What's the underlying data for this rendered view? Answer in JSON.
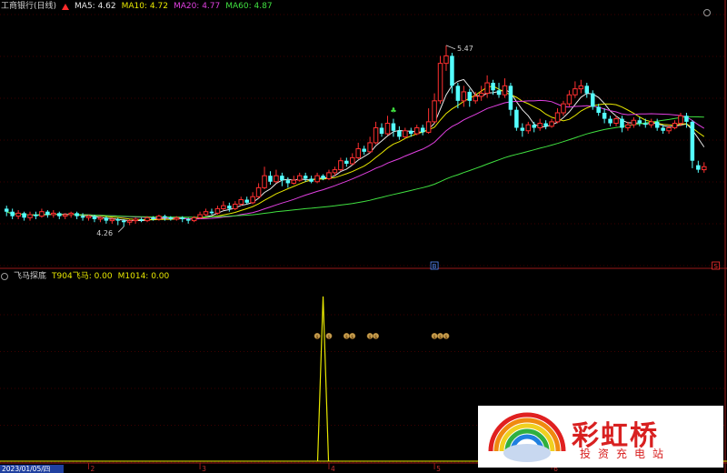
{
  "panel_title": "工商银行(日线)",
  "ma": [
    {
      "label": "MA5: 4.62",
      "color": "#e8e8e8"
    },
    {
      "label": "MA10: 4.72",
      "color": "#e8e800"
    },
    {
      "label": "MA20: 4.77",
      "color": "#e040e0"
    },
    {
      "label": "MA60: 4.87",
      "color": "#40e040"
    }
  ],
  "indicator": {
    "name": "飞马探底",
    "t904": "T904飞马: 0.00",
    "m1014": "M1014: 0.00"
  },
  "watermark": {
    "brand": "彩虹桥",
    "sub": "投资充电站"
  },
  "colors": {
    "up": "#ff3030",
    "down": "#54ffff",
    "bg": "#000000",
    "grid": "#7a0000",
    "axis": "#9a1a1a"
  },
  "chart_data": [
    {
      "type": "candlestick",
      "ylim": [
        4.0,
        5.7
      ],
      "annotations": [
        {
          "text": "5.47",
          "kind": "high",
          "value": 5.47,
          "index": 75
        },
        {
          "text": "4.26",
          "kind": "low",
          "value": 4.26,
          "index": 20
        }
      ],
      "axis_labels": [
        {
          "text": "2023/01/05/四",
          "index": 0
        },
        {
          "text": "2",
          "index": 14
        },
        {
          "text": "3",
          "index": 33
        },
        {
          "text": "4",
          "index": 55
        },
        {
          "text": "5",
          "index": 73
        },
        {
          "text": "6",
          "index": 93
        }
      ],
      "markers": [
        {
          "text": "B",
          "index": 73,
          "color": "#5a8cff"
        },
        {
          "text": "S",
          "index": 121,
          "color": "#ff3030"
        }
      ],
      "candles": [
        [
          4.38,
          4.36,
          4.4,
          4.33
        ],
        [
          4.36,
          4.33,
          4.38,
          4.31
        ],
        [
          4.33,
          4.35,
          4.37,
          4.31
        ],
        [
          4.35,
          4.32,
          4.36,
          4.3
        ],
        [
          4.32,
          4.34,
          4.36,
          4.3
        ],
        [
          4.34,
          4.33,
          4.36,
          4.31
        ],
        [
          4.33,
          4.36,
          4.38,
          4.32
        ],
        [
          4.36,
          4.34,
          4.37,
          4.32
        ],
        [
          4.34,
          4.35,
          4.37,
          4.32
        ],
        [
          4.35,
          4.33,
          4.36,
          4.31
        ],
        [
          4.33,
          4.34,
          4.35,
          4.31
        ],
        [
          4.34,
          4.35,
          4.36,
          4.32
        ],
        [
          4.35,
          4.33,
          4.36,
          4.31
        ],
        [
          4.33,
          4.32,
          4.35,
          4.3
        ],
        [
          4.32,
          4.33,
          4.34,
          4.3
        ],
        [
          4.33,
          4.31,
          4.34,
          4.29
        ],
        [
          4.31,
          4.32,
          4.33,
          4.29
        ],
        [
          4.32,
          4.3,
          4.33,
          4.28
        ],
        [
          4.3,
          4.31,
          4.32,
          4.28
        ],
        [
          4.31,
          4.3,
          4.32,
          4.27
        ],
        [
          4.3,
          4.29,
          4.31,
          4.26
        ],
        [
          4.29,
          4.3,
          4.31,
          4.27
        ],
        [
          4.3,
          4.31,
          4.32,
          4.28
        ],
        [
          4.31,
          4.3,
          4.32,
          4.29
        ],
        [
          4.3,
          4.32,
          4.33,
          4.29
        ],
        [
          4.32,
          4.31,
          4.33,
          4.3
        ],
        [
          4.31,
          4.33,
          4.34,
          4.3
        ],
        [
          4.33,
          4.32,
          4.34,
          4.3
        ],
        [
          4.32,
          4.31,
          4.33,
          4.3
        ],
        [
          4.31,
          4.32,
          4.33,
          4.3
        ],
        [
          4.32,
          4.31,
          4.33,
          4.29
        ],
        [
          4.31,
          4.3,
          4.32,
          4.28
        ],
        [
          4.3,
          4.32,
          4.33,
          4.29
        ],
        [
          4.32,
          4.34,
          4.36,
          4.31
        ],
        [
          4.34,
          4.36,
          4.38,
          4.33
        ],
        [
          4.36,
          4.35,
          4.38,
          4.34
        ],
        [
          4.35,
          4.38,
          4.4,
          4.34
        ],
        [
          4.38,
          4.4,
          4.43,
          4.37
        ],
        [
          4.4,
          4.38,
          4.42,
          4.36
        ],
        [
          4.38,
          4.41,
          4.43,
          4.37
        ],
        [
          4.41,
          4.44,
          4.46,
          4.4
        ],
        [
          4.44,
          4.42,
          4.46,
          4.41
        ],
        [
          4.42,
          4.46,
          4.49,
          4.41
        ],
        [
          4.46,
          4.52,
          4.55,
          4.45
        ],
        [
          4.52,
          4.6,
          4.66,
          4.51
        ],
        [
          4.6,
          4.56,
          4.63,
          4.54
        ],
        [
          4.56,
          4.6,
          4.64,
          4.55
        ],
        [
          4.6,
          4.57,
          4.62,
          4.53
        ],
        [
          4.57,
          4.55,
          4.59,
          4.52
        ],
        [
          4.55,
          4.57,
          4.6,
          4.54
        ],
        [
          4.57,
          4.6,
          4.62,
          4.56
        ],
        [
          4.6,
          4.58,
          4.62,
          4.56
        ],
        [
          4.58,
          4.56,
          4.6,
          4.55
        ],
        [
          4.56,
          4.6,
          4.62,
          4.55
        ],
        [
          4.6,
          4.58,
          4.61,
          4.57
        ],
        [
          4.58,
          4.62,
          4.64,
          4.57
        ],
        [
          4.62,
          4.64,
          4.66,
          4.6
        ],
        [
          4.64,
          4.7,
          4.72,
          4.63
        ],
        [
          4.7,
          4.68,
          4.72,
          4.66
        ],
        [
          4.68,
          4.72,
          4.75,
          4.67
        ],
        [
          4.72,
          4.78,
          4.82,
          4.71
        ],
        [
          4.78,
          4.76,
          4.8,
          4.74
        ],
        [
          4.76,
          4.82,
          4.86,
          4.75
        ],
        [
          4.82,
          4.92,
          4.96,
          4.81
        ],
        [
          4.92,
          4.88,
          4.95,
          4.86
        ],
        [
          4.88,
          4.95,
          5.0,
          4.87
        ],
        [
          4.95,
          4.9,
          4.98,
          4.86
        ],
        [
          4.9,
          4.86,
          4.93,
          4.84
        ],
        [
          4.86,
          4.9,
          4.92,
          4.85
        ],
        [
          4.9,
          4.88,
          4.92,
          4.86
        ],
        [
          4.88,
          4.92,
          4.94,
          4.87
        ],
        [
          4.92,
          4.89,
          4.94,
          4.87
        ],
        [
          4.89,
          4.96,
          5.05,
          4.88
        ],
        [
          4.96,
          5.1,
          5.15,
          4.95
        ],
        [
          5.1,
          5.35,
          5.4,
          5.08
        ],
        [
          5.35,
          5.4,
          5.47,
          5.3
        ],
        [
          5.4,
          5.2,
          5.42,
          5.15
        ],
        [
          5.2,
          5.1,
          5.22,
          5.05
        ],
        [
          5.1,
          5.16,
          5.2,
          5.06
        ],
        [
          5.16,
          5.1,
          5.18,
          5.06
        ],
        [
          5.1,
          5.13,
          5.16,
          5.08
        ],
        [
          5.13,
          5.15,
          5.2,
          5.1
        ],
        [
          5.15,
          5.22,
          5.27,
          5.12
        ],
        [
          5.22,
          5.17,
          5.24,
          5.14
        ],
        [
          5.17,
          5.14,
          5.22,
          5.12
        ],
        [
          5.14,
          5.2,
          5.25,
          5.12
        ],
        [
          5.2,
          5.04,
          5.22,
          5.0
        ],
        [
          5.04,
          4.92,
          5.06,
          4.9
        ],
        [
          4.92,
          4.9,
          4.95,
          4.86
        ],
        [
          4.9,
          4.94,
          4.96,
          4.88
        ],
        [
          4.94,
          4.92,
          4.96,
          4.89
        ],
        [
          4.92,
          4.95,
          4.98,
          4.9
        ],
        [
          4.95,
          4.93,
          4.97,
          4.91
        ],
        [
          4.93,
          4.96,
          4.98,
          4.92
        ],
        [
          4.96,
          5.02,
          5.05,
          4.95
        ],
        [
          5.02,
          5.08,
          5.1,
          5.0
        ],
        [
          5.08,
          5.14,
          5.17,
          5.06
        ],
        [
          5.14,
          5.18,
          5.23,
          5.12
        ],
        [
          5.18,
          5.2,
          5.24,
          5.15
        ],
        [
          5.2,
          5.15,
          5.22,
          5.12
        ],
        [
          5.15,
          5.06,
          5.17,
          5.04
        ],
        [
          5.06,
          5.02,
          5.08,
          5.0
        ],
        [
          5.02,
          4.98,
          5.05,
          4.95
        ],
        [
          4.98,
          4.95,
          5.0,
          4.93
        ],
        [
          4.95,
          4.98,
          5.0,
          4.93
        ],
        [
          4.98,
          4.92,
          5.0,
          4.89
        ],
        [
          4.92,
          4.94,
          4.96,
          4.9
        ],
        [
          4.94,
          4.97,
          4.99,
          4.92
        ],
        [
          4.97,
          4.95,
          4.99,
          4.93
        ],
        [
          4.95,
          4.94,
          4.98,
          4.92
        ],
        [
          4.94,
          4.96,
          4.98,
          4.92
        ],
        [
          4.96,
          4.92,
          4.98,
          4.9
        ],
        [
          4.92,
          4.9,
          4.94,
          4.88
        ],
        [
          4.9,
          4.92,
          4.94,
          4.88
        ],
        [
          4.92,
          4.95,
          4.97,
          4.91
        ],
        [
          4.95,
          5.0,
          5.02,
          4.93
        ],
        [
          5.0,
          4.96,
          5.02,
          4.92
        ],
        [
          4.96,
          4.7,
          4.97,
          4.65
        ],
        [
          4.67,
          4.64,
          4.7,
          4.62
        ],
        [
          4.64,
          4.66,
          4.69,
          4.62
        ]
      ]
    },
    {
      "type": "line",
      "name": "T904飞马",
      "ylim": [
        0,
        1
      ],
      "spike": {
        "index": 54,
        "value": 0.92
      },
      "icon_markers": [
        {
          "index": 53,
          "value": 0.7
        },
        {
          "index": 55,
          "value": 0.7
        },
        {
          "index": 58,
          "value": 0.7
        },
        {
          "index": 59,
          "value": 0.7
        },
        {
          "index": 62,
          "value": 0.7
        },
        {
          "index": 63,
          "value": 0.7
        },
        {
          "index": 73,
          "value": 0.7
        },
        {
          "index": 74,
          "value": 0.7
        },
        {
          "index": 75,
          "value": 0.7
        }
      ]
    }
  ]
}
